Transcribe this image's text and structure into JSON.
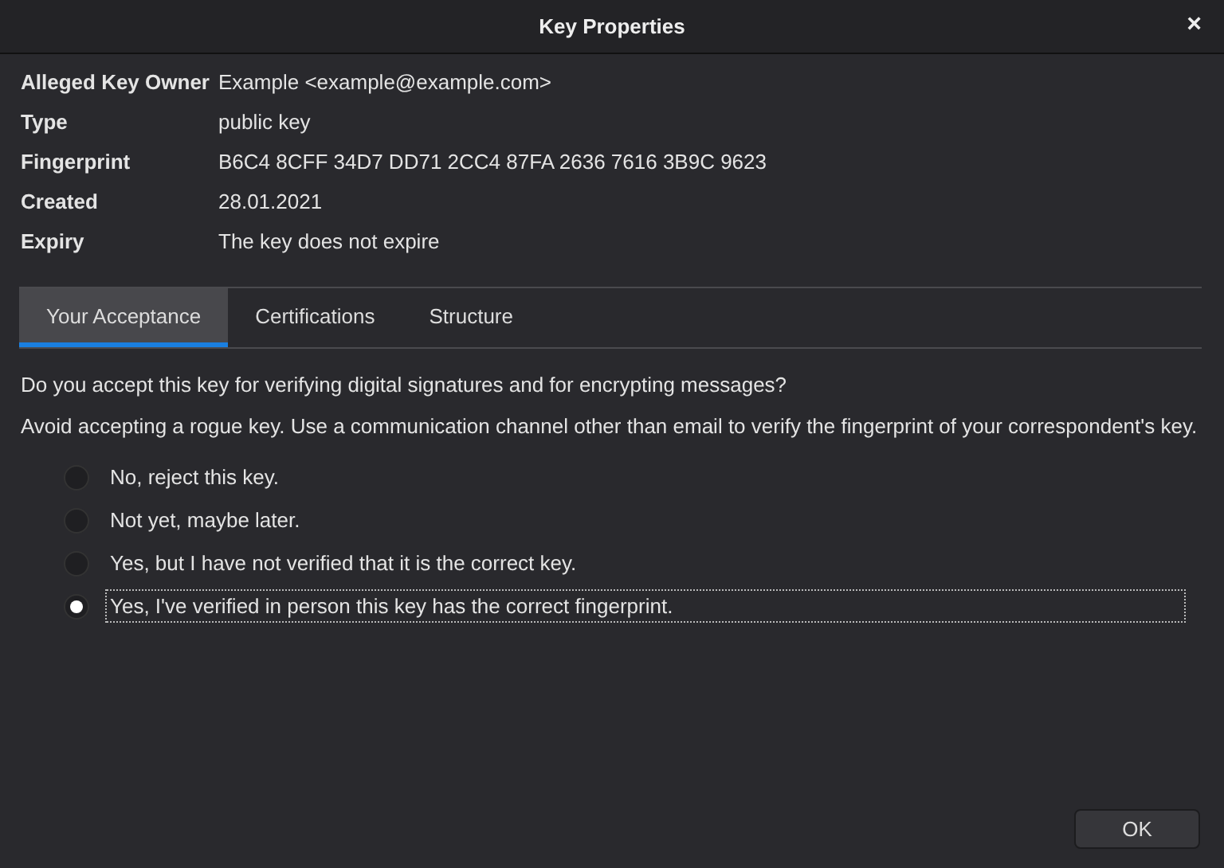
{
  "window": {
    "title": "Key Properties",
    "close": "×"
  },
  "properties": [
    {
      "label": "Alleged Key Owner",
      "value": "Example <example@example.com>"
    },
    {
      "label": "Type",
      "value": "public key"
    },
    {
      "label": "Fingerprint",
      "value": "B6C4 8CFF 34D7 DD71 2CC4 87FA 2636 7616 3B9C 9623"
    },
    {
      "label": "Created",
      "value": "28.01.2021"
    },
    {
      "label": "Expiry",
      "value": "The key does not expire"
    }
  ],
  "tabs": [
    {
      "label": "Your Acceptance",
      "selected": true
    },
    {
      "label": "Certifications",
      "selected": false
    },
    {
      "label": "Structure",
      "selected": false
    }
  ],
  "question": "Do you accept this key for verifying digital signatures and for encrypting messages?",
  "warning": "Avoid accepting a rogue key. Use a communication channel other than email to verify the fingerprint of your correspondent's key.",
  "options": [
    {
      "label": "No, reject this key.",
      "selected": false
    },
    {
      "label": "Not yet, maybe later.",
      "selected": false
    },
    {
      "label": "Yes, but I have not verified that it is the correct key.",
      "selected": false
    },
    {
      "label": "Yes, I've verified in person this key has the correct fingerprint.",
      "selected": true
    }
  ],
  "buttons": [
    "OK"
  ]
}
